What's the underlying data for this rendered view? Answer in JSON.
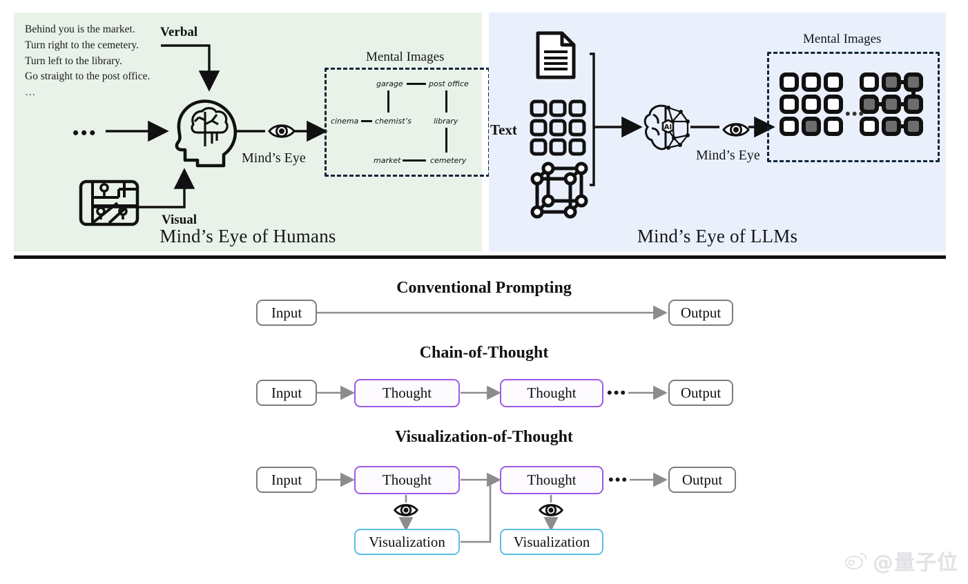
{
  "figure": {
    "panels": {
      "humans": {
        "caption": "Mind’s Eye of Humans",
        "bg": "#e9f2e9",
        "verbal_lines": [
          "Behind you is the market.",
          "Turn right to the cemetery.",
          "Turn left to the library.",
          "Go straight to the post office."
        ],
        "verbal_ellipsis": "…",
        "input_ellipsis": "•••",
        "verbal_label": "Verbal",
        "visual_label": "Visual",
        "minds_eye_label": "Mind’s Eye",
        "mental_images_title": "Mental Images",
        "map_nodes": [
          "garage",
          "post office",
          "cinema",
          "chemist’s",
          "library",
          "market",
          "cemetery"
        ]
      },
      "llms": {
        "caption": "Mind’s Eye of LLMs",
        "bg": "#eaf0fb",
        "text_label": "Text",
        "minds_eye_label": "Mind’s Eye",
        "mental_images_title": "Mental Images",
        "grid_ellipsis": "•••",
        "ai_badge": "AI"
      }
    },
    "flows": [
      {
        "id": "conventional",
        "title": "Conventional Prompting",
        "nodes": [
          {
            "type": "io",
            "label": "Input"
          },
          {
            "type": "io",
            "label": "Output"
          }
        ]
      },
      {
        "id": "chain-of-thought",
        "title": "Chain-of-Thought",
        "ellipsis": "•••",
        "nodes": [
          {
            "type": "io",
            "label": "Input"
          },
          {
            "type": "thought",
            "label": "Thought"
          },
          {
            "type": "thought",
            "label": "Thought"
          },
          {
            "type": "io",
            "label": "Output"
          }
        ]
      },
      {
        "id": "visualization-of-thought",
        "title": "Visualization-of-Thought",
        "ellipsis": "•••",
        "nodes": [
          {
            "type": "io",
            "label": "Input"
          },
          {
            "type": "thought",
            "label": "Thought"
          },
          {
            "type": "thought",
            "label": "Thought"
          },
          {
            "type": "io",
            "label": "Output"
          },
          {
            "type": "vis",
            "label": "Visualization"
          },
          {
            "type": "vis",
            "label": "Visualization"
          }
        ]
      }
    ],
    "colors": {
      "thought_border": "#9b59e8",
      "visualization_border": "#5bbce4",
      "io_border": "#7d7d7d",
      "arrow": "#8c8c8c",
      "rule": "#111111"
    },
    "watermark": "@量子位"
  }
}
